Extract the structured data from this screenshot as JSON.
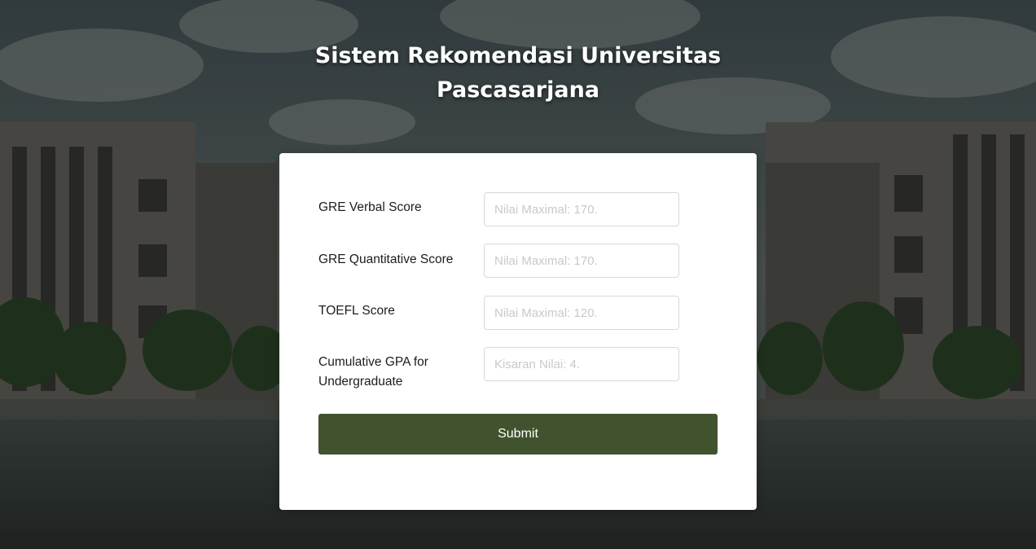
{
  "page": {
    "title_line1": "Sistem Rekomendasi Universitas",
    "title_line2": "Pascasarjana"
  },
  "form": {
    "fields": [
      {
        "label": "GRE Verbal Score",
        "placeholder": "Nilai Maximal: 170.",
        "value": ""
      },
      {
        "label": "GRE Quantitative Score",
        "placeholder": "Nilai Maximal: 170.",
        "value": ""
      },
      {
        "label": "TOEFL Score",
        "placeholder": "Nilai Maximal: 120.",
        "value": ""
      },
      {
        "label": "Cumulative GPA for Undergraduate",
        "placeholder": "Kisaran Nilai: 4.",
        "value": ""
      }
    ],
    "submit_label": "Submit"
  },
  "colors": {
    "submit_bg": "#41532e",
    "card_bg": "#ffffff",
    "title_text": "#ffffff"
  }
}
